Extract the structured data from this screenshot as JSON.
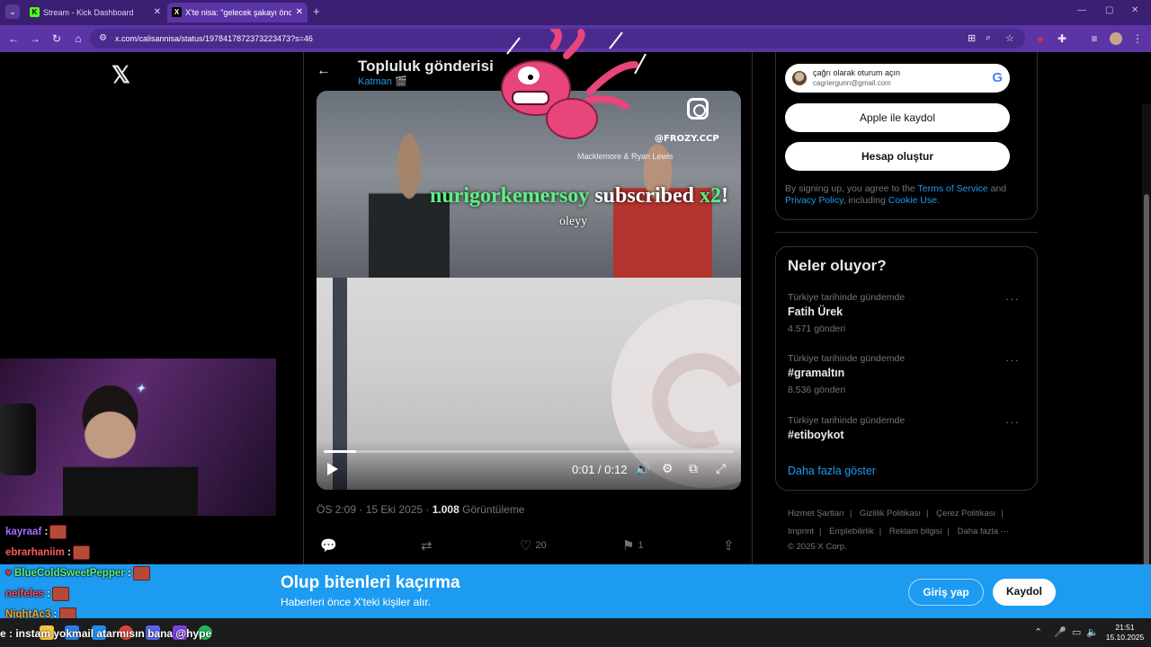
{
  "browser": {
    "tabs": [
      {
        "label": "Stream - Kick Dashboard",
        "favicon": "kick-icon",
        "active": false
      },
      {
        "label": "X'te nisa: \"gelecek şakayı önce",
        "favicon": "x-icon",
        "active": true
      }
    ],
    "url": "x.com/calisannisa/status/1978417872373223473?s=46"
  },
  "post": {
    "header_title": "Topluluk gönderisi",
    "header_sub": "Katman 🎬",
    "meta_time": "ÖS 2:09 · 15 Eki 2025 · ",
    "views": "1.008",
    "views_label": " Görüntüleme",
    "likes": "20",
    "bookmarks": "1"
  },
  "video": {
    "watermark_handle": "@FROZY.CCP",
    "watermark_credit": "Macklemore & Ryan Lewis",
    "current_time": "0:01",
    "separator": " / ",
    "duration": "0:12",
    "progress_fraction": 0.08
  },
  "stream_alert": {
    "username": "nurigorkemersoy",
    "action": " subscribed ",
    "multiplier": "x2",
    "bang": "!",
    "message": "oleyy"
  },
  "signin": {
    "google_line1": "çağrı olarak oturum açın",
    "google_line2": "cagriergunn@gmail.com",
    "apple_label": "Apple ile kaydol",
    "create_label": "Hesap oluştur",
    "legal_pre": "By signing up, you agree to the ",
    "legal_tos": "Terms of Service",
    "legal_and": " and ",
    "legal_privacy": "Privacy Policy",
    "legal_incl": ", including ",
    "legal_cookie": "Cookie Use",
    "legal_end": "."
  },
  "trends": {
    "heading": "Neler oluyor?",
    "items": [
      {
        "context": "Türkiye tarihinde gündemde",
        "name": "Fatih Ürek",
        "count": "4.571 gönderi"
      },
      {
        "context": "Türkiye tarihinde gündemde",
        "name": "#gramaltın",
        "count": "8.536 gönderi"
      },
      {
        "context": "Türkiye tarihinde gündemde",
        "name": "#etiboykot",
        "count": ""
      }
    ],
    "show_more": "Daha fazla göster"
  },
  "footer": {
    "row1": [
      "Hizmet Şartları",
      "|",
      "Gizlilik Politikası",
      "|",
      "Çerez Politikası",
      "|"
    ],
    "row2": [
      "Imprint",
      "|",
      "Erişilebilirlik",
      "|",
      "Reklam bilgisi",
      "|",
      "Daha fazla ···"
    ],
    "copyright": "© 2025 X Corp."
  },
  "banner": {
    "title": "Olup bitenleri kaçırma",
    "subtitle": "Haberleri önce X'teki kişiler alır.",
    "login": "Giriş yap",
    "signup": "Kaydol"
  },
  "chat": [
    {
      "user": "kayraaf",
      "color": "#a46cff",
      "sep": " :"
    },
    {
      "user": "ebrarhaniim",
      "color": "#ff5a5a",
      "sep": " :"
    },
    {
      "user": "BlueColdSweetPepper",
      "color": "#5ef084",
      "sep": " :"
    },
    {
      "user": "neifeles",
      "color": "#ff4d6d",
      "sep": " :"
    },
    {
      "user": "NightAc3",
      "color": "#ffa726",
      "sep": " :"
    }
  ],
  "ticker": "e : instam yokmail atarmısın bana @hype",
  "clock": {
    "time": "21:51",
    "date": "15.10.2025"
  },
  "colors": {
    "x_blue": "#1d9bf0",
    "chrome_purple": "#5b35a6",
    "kick_green": "#53fc18"
  }
}
